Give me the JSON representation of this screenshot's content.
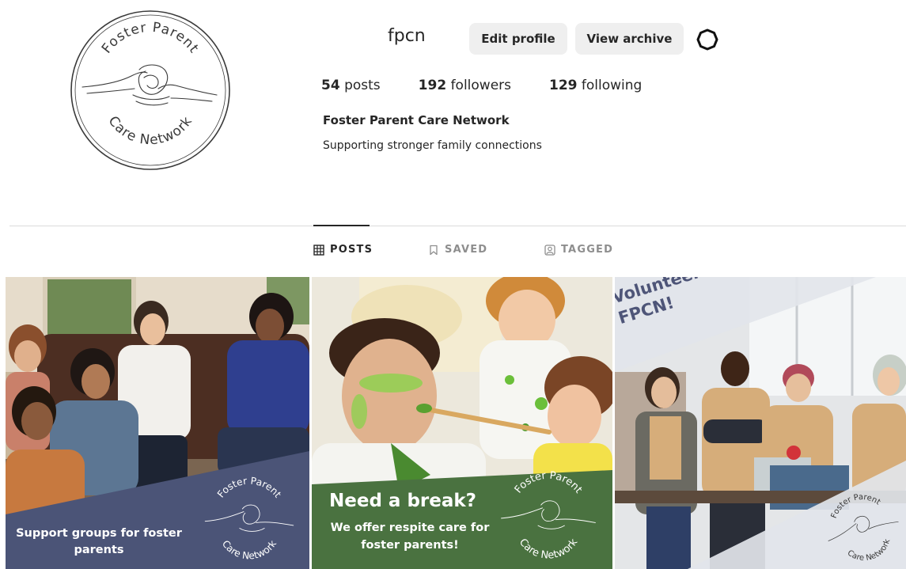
{
  "profile": {
    "username": "fpcn",
    "edit_profile_label": "Edit profile",
    "view_archive_label": "View archive",
    "settings_icon": "gear-icon",
    "display_name": "Foster Parent Care Network",
    "bio": "Supporting stronger family connections",
    "stats": {
      "posts_count": "54",
      "posts_label": "posts",
      "followers_count": "192",
      "followers_label": "followers",
      "following_count": "129",
      "following_label": "following"
    },
    "logo": {
      "top_text": "Foster Parent",
      "bottom_text": "Care Network"
    }
  },
  "tabs": [
    {
      "label": "POSTS",
      "icon": "grid-icon",
      "active": true
    },
    {
      "label": "SAVED",
      "icon": "bookmark-icon",
      "active": false
    },
    {
      "label": "TAGGED",
      "icon": "tag-person-icon",
      "active": false
    }
  ],
  "posts": [
    {
      "caption": "Support groups for foster parents",
      "logo_top": "Foster Parent",
      "logo_bottom": "Care Network",
      "banner_color": "#4b5477"
    },
    {
      "headline": "Need a break?",
      "subtext": "We offer respite care for foster parents!",
      "logo_top": "Foster Parent",
      "logo_bottom": "Care Network",
      "banner_color": "#4a7240"
    },
    {
      "headline": "Volunteer with FPCN!",
      "logo_top": "Foster Parent",
      "logo_bottom": "Care Network",
      "banner_color": "#e2e5ea"
    }
  ],
  "colors": {
    "button_bg": "#efefef",
    "text": "#262626",
    "muted": "#8e8e8e",
    "divider": "#dbdbdb"
  }
}
